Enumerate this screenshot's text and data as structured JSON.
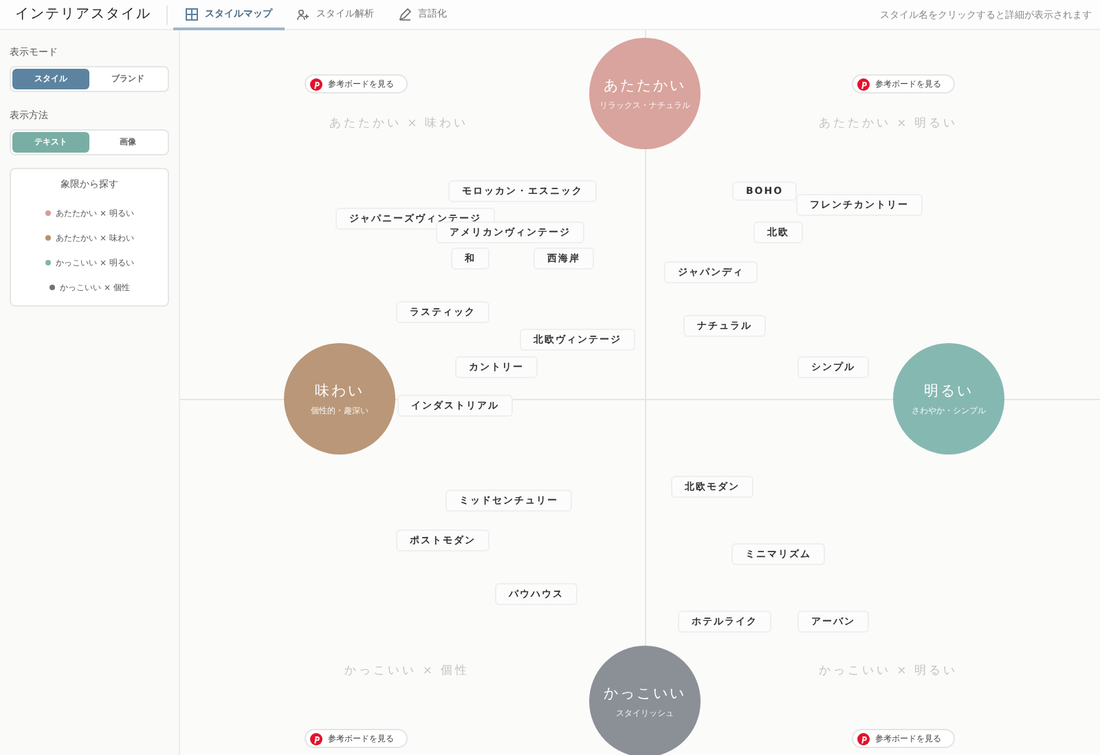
{
  "header": {
    "title": "インテリアスタイル",
    "hint": "スタイル名をクリックすると詳細が表示されます",
    "tabs": [
      {
        "label": "スタイルマップ",
        "kind": "map",
        "selected": true
      },
      {
        "label": "スタイル解析",
        "kind": "analysis",
        "selected": false
      },
      {
        "label": "言語化",
        "kind": "write",
        "selected": false
      }
    ]
  },
  "sidebar": {
    "groups": [
      {
        "label": "表示モード",
        "options": [
          {
            "label": "スタイル",
            "selected": true
          },
          {
            "label": "ブランド",
            "selected": false
          }
        ]
      },
      {
        "label": "表示方法",
        "options": [
          {
            "label": "テキスト",
            "selected": true
          },
          {
            "label": "画像",
            "selected": false
          }
        ]
      }
    ],
    "quadrants": {
      "title": "象限から探す",
      "items": [
        {
          "label": "あたたかい × 明るい",
          "color": "#d59d96"
        },
        {
          "label": "あたたかい × 味わい",
          "color": "#b8906c"
        },
        {
          "label": "かっこいい × 明るい",
          "color": "#7fb5ae"
        },
        {
          "label": "かっこいい × 個性",
          "color": "#6f737b"
        }
      ]
    }
  },
  "map": {
    "axes": [
      {
        "title": "あたたかい",
        "subtitle": "リラックス・ナチュラル",
        "color": "#d8a49d"
      },
      {
        "title": "味わい",
        "subtitle": "個性的・趣深い",
        "color": "#b99778"
      },
      {
        "title": "明るい",
        "subtitle": "さわやか・シンプル",
        "color": "#86b8b2"
      },
      {
        "title": "かっこいい",
        "subtitle": "スタイリッシュ",
        "color": "#8b8f96"
      }
    ],
    "quadrants": [
      {
        "label": "あたたかい × 味わい",
        "board_button": "参考ボードを見る"
      },
      {
        "label": "あたたかい × 明るい",
        "board_button": "参考ボードを見る"
      },
      {
        "label": "かっこいい × 個性",
        "board_button": "参考ボードを見る"
      },
      {
        "label": "かっこいい × 明るい",
        "board_button": "参考ボードを見る"
      }
    ],
    "styles": [
      "モロッカン・エスニック",
      "ジャパニーズヴィンテージ",
      "アメリカンヴィンテージ",
      "和",
      "西海岸",
      "ラスティック",
      "北欧ヴィンテージ",
      "カントリー",
      "インダストリアル",
      "BOHO",
      "フレンチカントリー",
      "北欧",
      "ジャパンディ",
      "ナチュラル",
      "シンプル",
      "ミッドセンチュリー",
      "ポストモダン",
      "バウハウス",
      "北欧モダン",
      "ミニマリズム",
      "ホテルライク",
      "アーバン"
    ]
  }
}
